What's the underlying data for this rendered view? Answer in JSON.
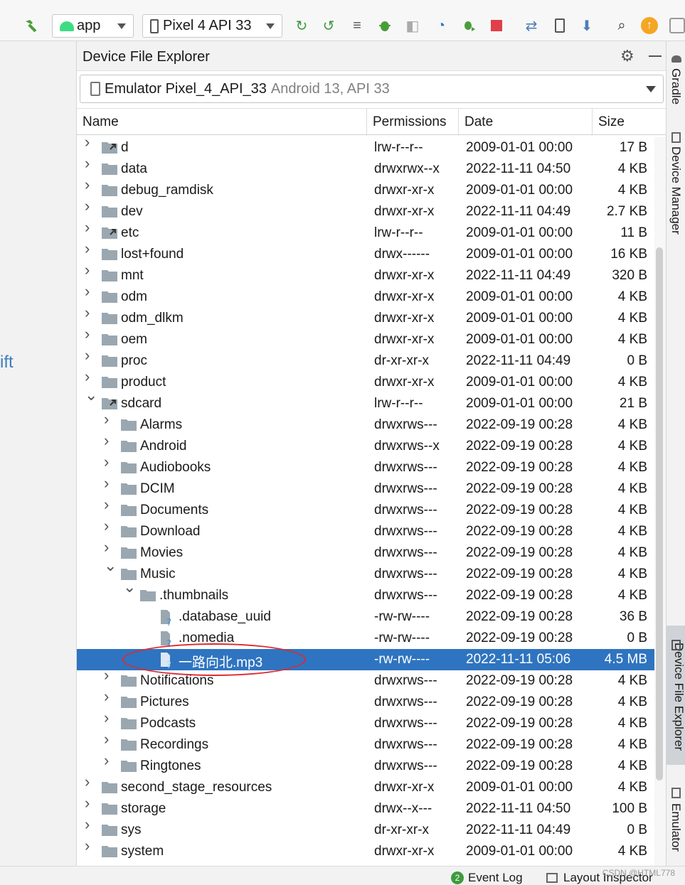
{
  "toolbar": {
    "run_config": "app",
    "device": "Pixel 4 API 33",
    "icons": [
      "hammer-icon",
      "android-icon",
      "phone-icon",
      "rerun-icon",
      "apply-changes-icon",
      "apply-code-icon",
      "debug-icon",
      "attach-icon",
      "profiler-icon",
      "bug-run-icon",
      "stop-icon",
      "sync-icon",
      "device-manager-icon",
      "sdk-icon",
      "search-icon",
      "update-icon",
      "avatar-icon"
    ]
  },
  "left_fragment": "ift",
  "panel": {
    "title": "Device File Explorer",
    "device_name": "Emulator Pixel_4_API_33",
    "device_sub": "Android 13, API 33"
  },
  "columns": {
    "name": "Name",
    "permissions": "Permissions",
    "date": "Date",
    "size": "Size"
  },
  "rows": [
    {
      "name": "d",
      "type": "link",
      "level": 0,
      "expand": "collapsed",
      "perm": "lrw-r--r--",
      "date": "2009-01-01 00:00",
      "size": "17 B"
    },
    {
      "name": "data",
      "type": "folder",
      "level": 0,
      "expand": "collapsed",
      "perm": "drwxrwx--x",
      "date": "2022-11-11 04:50",
      "size": "4 KB"
    },
    {
      "name": "debug_ramdisk",
      "type": "folder",
      "level": 0,
      "expand": "collapsed",
      "perm": "drwxr-xr-x",
      "date": "2009-01-01 00:00",
      "size": "4 KB"
    },
    {
      "name": "dev",
      "type": "folder",
      "level": 0,
      "expand": "collapsed",
      "perm": "drwxr-xr-x",
      "date": "2022-11-11 04:49",
      "size": "2.7 KB"
    },
    {
      "name": "etc",
      "type": "link",
      "level": 0,
      "expand": "collapsed",
      "perm": "lrw-r--r--",
      "date": "2009-01-01 00:00",
      "size": "11 B"
    },
    {
      "name": "lost+found",
      "type": "folder",
      "level": 0,
      "expand": "collapsed",
      "perm": "drwx------",
      "date": "2009-01-01 00:00",
      "size": "16 KB"
    },
    {
      "name": "mnt",
      "type": "folder",
      "level": 0,
      "expand": "collapsed",
      "perm": "drwxr-xr-x",
      "date": "2022-11-11 04:49",
      "size": "320 B"
    },
    {
      "name": "odm",
      "type": "folder",
      "level": 0,
      "expand": "collapsed",
      "perm": "drwxr-xr-x",
      "date": "2009-01-01 00:00",
      "size": "4 KB"
    },
    {
      "name": "odm_dlkm",
      "type": "folder",
      "level": 0,
      "expand": "collapsed",
      "perm": "drwxr-xr-x",
      "date": "2009-01-01 00:00",
      "size": "4 KB"
    },
    {
      "name": "oem",
      "type": "folder",
      "level": 0,
      "expand": "collapsed",
      "perm": "drwxr-xr-x",
      "date": "2009-01-01 00:00",
      "size": "4 KB"
    },
    {
      "name": "proc",
      "type": "folder",
      "level": 0,
      "expand": "collapsed",
      "perm": "dr-xr-xr-x",
      "date": "2022-11-11 04:49",
      "size": "0 B"
    },
    {
      "name": "product",
      "type": "folder",
      "level": 0,
      "expand": "collapsed",
      "perm": "drwxr-xr-x",
      "date": "2009-01-01 00:00",
      "size": "4 KB"
    },
    {
      "name": "sdcard",
      "type": "link",
      "level": 0,
      "expand": "expanded",
      "perm": "lrw-r--r--",
      "date": "2009-01-01 00:00",
      "size": "21 B"
    },
    {
      "name": "Alarms",
      "type": "folder",
      "level": 1,
      "expand": "collapsed",
      "perm": "drwxrws---",
      "date": "2022-09-19 00:28",
      "size": "4 KB"
    },
    {
      "name": "Android",
      "type": "folder",
      "level": 1,
      "expand": "collapsed",
      "perm": "drwxrws--x",
      "date": "2022-09-19 00:28",
      "size": "4 KB"
    },
    {
      "name": "Audiobooks",
      "type": "folder",
      "level": 1,
      "expand": "collapsed",
      "perm": "drwxrws---",
      "date": "2022-09-19 00:28",
      "size": "4 KB"
    },
    {
      "name": "DCIM",
      "type": "folder",
      "level": 1,
      "expand": "collapsed",
      "perm": "drwxrws---",
      "date": "2022-09-19 00:28",
      "size": "4 KB"
    },
    {
      "name": "Documents",
      "type": "folder",
      "level": 1,
      "expand": "collapsed",
      "perm": "drwxrws---",
      "date": "2022-09-19 00:28",
      "size": "4 KB"
    },
    {
      "name": "Download",
      "type": "folder",
      "level": 1,
      "expand": "collapsed",
      "perm": "drwxrws---",
      "date": "2022-09-19 00:28",
      "size": "4 KB"
    },
    {
      "name": "Movies",
      "type": "folder",
      "level": 1,
      "expand": "collapsed",
      "perm": "drwxrws---",
      "date": "2022-09-19 00:28",
      "size": "4 KB"
    },
    {
      "name": "Music",
      "type": "folder",
      "level": 1,
      "expand": "expanded",
      "perm": "drwxrws---",
      "date": "2022-09-19 00:28",
      "size": "4 KB"
    },
    {
      "name": ".thumbnails",
      "type": "folder",
      "level": 2,
      "expand": "expanded",
      "perm": "drwxrws---",
      "date": "2022-09-19 00:28",
      "size": "4 KB"
    },
    {
      "name": ".database_uuid",
      "type": "file",
      "level": 3,
      "expand": "none",
      "perm": "-rw-rw----",
      "date": "2022-09-19 00:28",
      "size": "36 B"
    },
    {
      "name": ".nomedia",
      "type": "file",
      "level": 3,
      "expand": "none",
      "perm": "-rw-rw----",
      "date": "2022-09-19 00:28",
      "size": "0 B"
    },
    {
      "name": "一路向北.mp3",
      "type": "file",
      "level": 3,
      "expand": "none",
      "perm": "-rw-rw----",
      "date": "2022-11-11 05:06",
      "size": "4.5 MB",
      "selected": true
    },
    {
      "name": "Notifications",
      "type": "folder",
      "level": 1,
      "expand": "collapsed",
      "perm": "drwxrws---",
      "date": "2022-09-19 00:28",
      "size": "4 KB"
    },
    {
      "name": "Pictures",
      "type": "folder",
      "level": 1,
      "expand": "collapsed",
      "perm": "drwxrws---",
      "date": "2022-09-19 00:28",
      "size": "4 KB"
    },
    {
      "name": "Podcasts",
      "type": "folder",
      "level": 1,
      "expand": "collapsed",
      "perm": "drwxrws---",
      "date": "2022-09-19 00:28",
      "size": "4 KB"
    },
    {
      "name": "Recordings",
      "type": "folder",
      "level": 1,
      "expand": "collapsed",
      "perm": "drwxrws---",
      "date": "2022-09-19 00:28",
      "size": "4 KB"
    },
    {
      "name": "Ringtones",
      "type": "folder",
      "level": 1,
      "expand": "collapsed",
      "perm": "drwxrws---",
      "date": "2022-09-19 00:28",
      "size": "4 KB"
    },
    {
      "name": "second_stage_resources",
      "type": "folder",
      "level": 0,
      "expand": "collapsed",
      "perm": "drwxr-xr-x",
      "date": "2009-01-01 00:00",
      "size": "4 KB"
    },
    {
      "name": "storage",
      "type": "folder",
      "level": 0,
      "expand": "collapsed",
      "perm": "drwx--x---",
      "date": "2022-11-11 04:50",
      "size": "100 B"
    },
    {
      "name": "sys",
      "type": "folder",
      "level": 0,
      "expand": "collapsed",
      "perm": "dr-xr-xr-x",
      "date": "2022-11-11 04:49",
      "size": "0 B"
    },
    {
      "name": "system",
      "type": "folder",
      "level": 0,
      "expand": "collapsed",
      "perm": "drwxr-xr-x",
      "date": "2009-01-01 00:00",
      "size": "4 KB"
    }
  ],
  "right_tabs": {
    "gradle": "Gradle",
    "device_manager": "Device Manager",
    "device_file_explorer": "Device File Explorer",
    "emulator": "Emulator"
  },
  "status": {
    "event_log_count": "2",
    "event_log": "Event Log",
    "layout_inspector": "Layout Inspector",
    "watermark": "CSDN @HTML778"
  },
  "colors": {
    "selection": "#2f74c0",
    "folder": "#9aa7b0",
    "annotation": "#e0282e",
    "accent_green": "#3e9b3e"
  }
}
